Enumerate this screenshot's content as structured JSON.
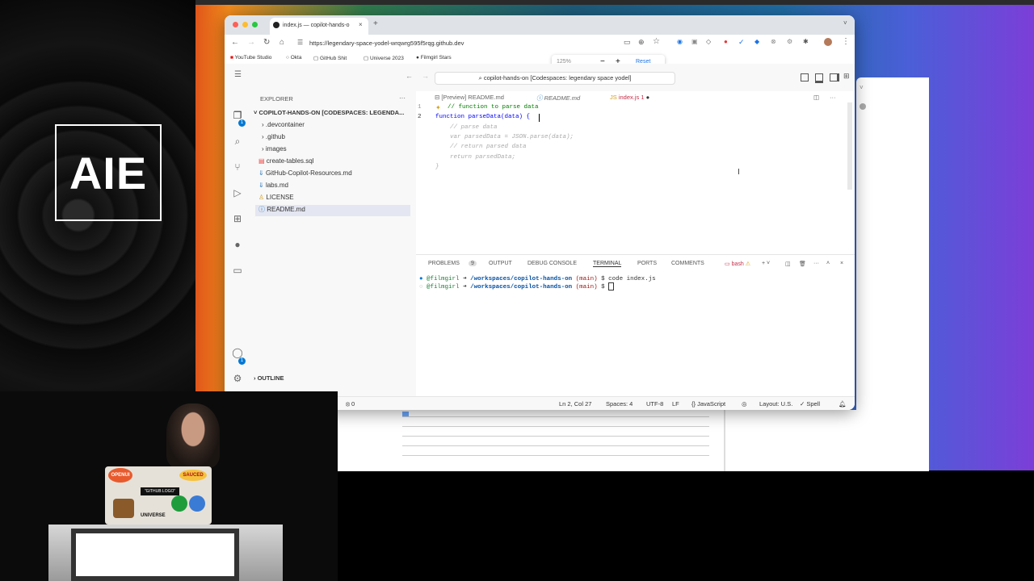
{
  "branding": {
    "logo_text": "AIE"
  },
  "browser": {
    "tab_title": "index.js — copilot-hands-o",
    "url": "https://legendary-space-yodel-wrqwrg595f5rqg.github.dev",
    "bookmarks": [
      "YouTube Studio",
      "Okta",
      "GitHub Shit",
      "Universe 2023",
      "Filmgirl Stars"
    ],
    "zoom_level": "125%",
    "zoom_minus": "−",
    "zoom_plus": "+",
    "zoom_reset": "Reset"
  },
  "vscode": {
    "command_center": "copilot-hands-on [Codespaces: legendary space yodel]",
    "explorer": {
      "title": "EXPLORER",
      "more": "···",
      "root": "COPILOT-HANDS-ON [CODESPACES: LEGENDA...",
      "items": [
        ".devcontainer",
        ".github",
        "images",
        "create-tables.sql",
        "GitHub-Copilot-Resources.md",
        "labs.md",
        "LICENSE",
        "README.md"
      ],
      "outline": "OUTLINE"
    },
    "editor_tabs": [
      "[Preview] README.md",
      "README.md",
      "index.js",
      "1"
    ],
    "code": {
      "line_numbers": [
        "1",
        "2"
      ],
      "lines": [
        "// function to parse data",
        "function parseData(data) {",
        "    // parse data",
        "    var parsedData = JSON.parse(data);",
        "    // return parsed data",
        "    return parsedData;",
        "}"
      ]
    },
    "panel": {
      "tabs": [
        "PROBLEMS",
        "9",
        "OUTPUT",
        "DEBUG CONSOLE",
        "TERMINAL",
        "PORTS",
        "COMMENTS"
      ],
      "shell": "bash",
      "terminal": [
        {
          "user": "@filmgirl",
          "path": "/workspaces/copilot-hands-on",
          "branch": "(main)",
          "cmd": "$ code index.js"
        },
        {
          "user": "@filmgirl",
          "path": "/workspaces/copilot-hands-on",
          "branch": "(main)",
          "cmd": "$"
        }
      ]
    },
    "status": {
      "remote": "odel",
      "branch": "main",
      "errors": "1",
      "warnings": "0",
      "info": "8",
      "ports": "0",
      "position": "Ln 2, Col 27",
      "spaces": "Spaces: 4",
      "encoding": "UTF-8",
      "eol": "LF",
      "language": "JavaScript",
      "layout": "Layout: U.S.",
      "spell": "Spell"
    }
  },
  "laptop": {
    "stickers": [
      "OPENUI",
      "SAUCED",
      "\"GITHUB LOGO\"",
      "UNIVERSE"
    ]
  },
  "colors": {
    "accent": "#0078d4",
    "code_comment": "#008000",
    "keyword": "#0000ff",
    "string": "#a31515",
    "terminal_user": "#1a7f37",
    "terminal_path": "#0451a5"
  }
}
